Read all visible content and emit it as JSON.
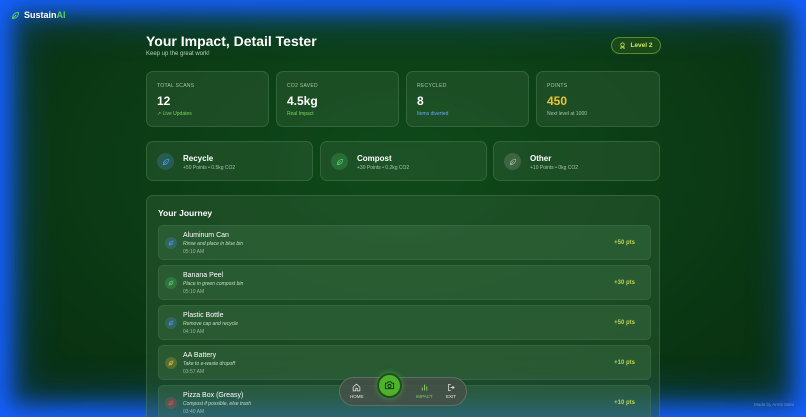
{
  "brand": {
    "name": "Sustain",
    "accent": "AI"
  },
  "header": {
    "title": "Your Impact, Detail Tester",
    "subtitle": "Keep up the great work!"
  },
  "level": {
    "label": "Level 2"
  },
  "stats": [
    {
      "label": "TOTAL SCANS",
      "value": "12",
      "sub": "↗ Live Updates",
      "sub_color": "#7fd35f",
      "value_color": "#ffffff"
    },
    {
      "label": "CO2 SAVED",
      "value": "4.5kg",
      "sub": "Real Impact",
      "sub_color": "#7fd35f",
      "value_color": "#ffffff"
    },
    {
      "label": "RECYCLED",
      "value": "8",
      "sub": "Items diverted",
      "sub_color": "#6aa8ff",
      "value_color": "#ffffff"
    },
    {
      "label": "POINTS",
      "value": "450",
      "sub": "Next level at 1000",
      "sub_color": "#a9c4ab",
      "value_color": "#f2c230"
    }
  ],
  "categories": [
    {
      "name": "Recycle",
      "sub": "+50 Points • 0.5kg CO2",
      "icon": "leaf-icon",
      "color": "#4a90d9"
    },
    {
      "name": "Compost",
      "sub": "+30 Points • 0.2kg CO2",
      "icon": "leaf-icon",
      "color": "#4ec36a"
    },
    {
      "name": "Other",
      "sub": "+10 Points • 0kg CO2",
      "icon": "leaf-icon",
      "color": "#9aa89c"
    }
  ],
  "journey": {
    "title": "Your Journey",
    "items": [
      {
        "name": "Aluminum Can",
        "tip": "Rinse and place in blue bin",
        "time": "05:10 AM",
        "points": "+50 pts",
        "color": "#4a90d9"
      },
      {
        "name": "Banana Peel",
        "tip": "Place in green compost bin",
        "time": "05:10 AM",
        "points": "+30 pts",
        "color": "#4ec36a"
      },
      {
        "name": "Plastic Bottle",
        "tip": "Remove cap and recycle",
        "time": "04:10 AM",
        "points": "+50 pts",
        "color": "#4a90d9"
      },
      {
        "name": "AA Battery",
        "tip": "Take to e-waste dropoff",
        "time": "03:57 AM",
        "points": "+10 pts",
        "color": "#d9b23a"
      },
      {
        "name": "Pizza Box (Greasy)",
        "tip": "Compost if possible, else trash",
        "time": "03:40 AM",
        "points": "+10 pts",
        "color": "#d94a4a"
      }
    ]
  },
  "nav": {
    "home": "HOME",
    "impact": "IMPACT",
    "exit": "EXIT"
  },
  "footer": {
    "made_by": "Made by Armit Saini"
  }
}
